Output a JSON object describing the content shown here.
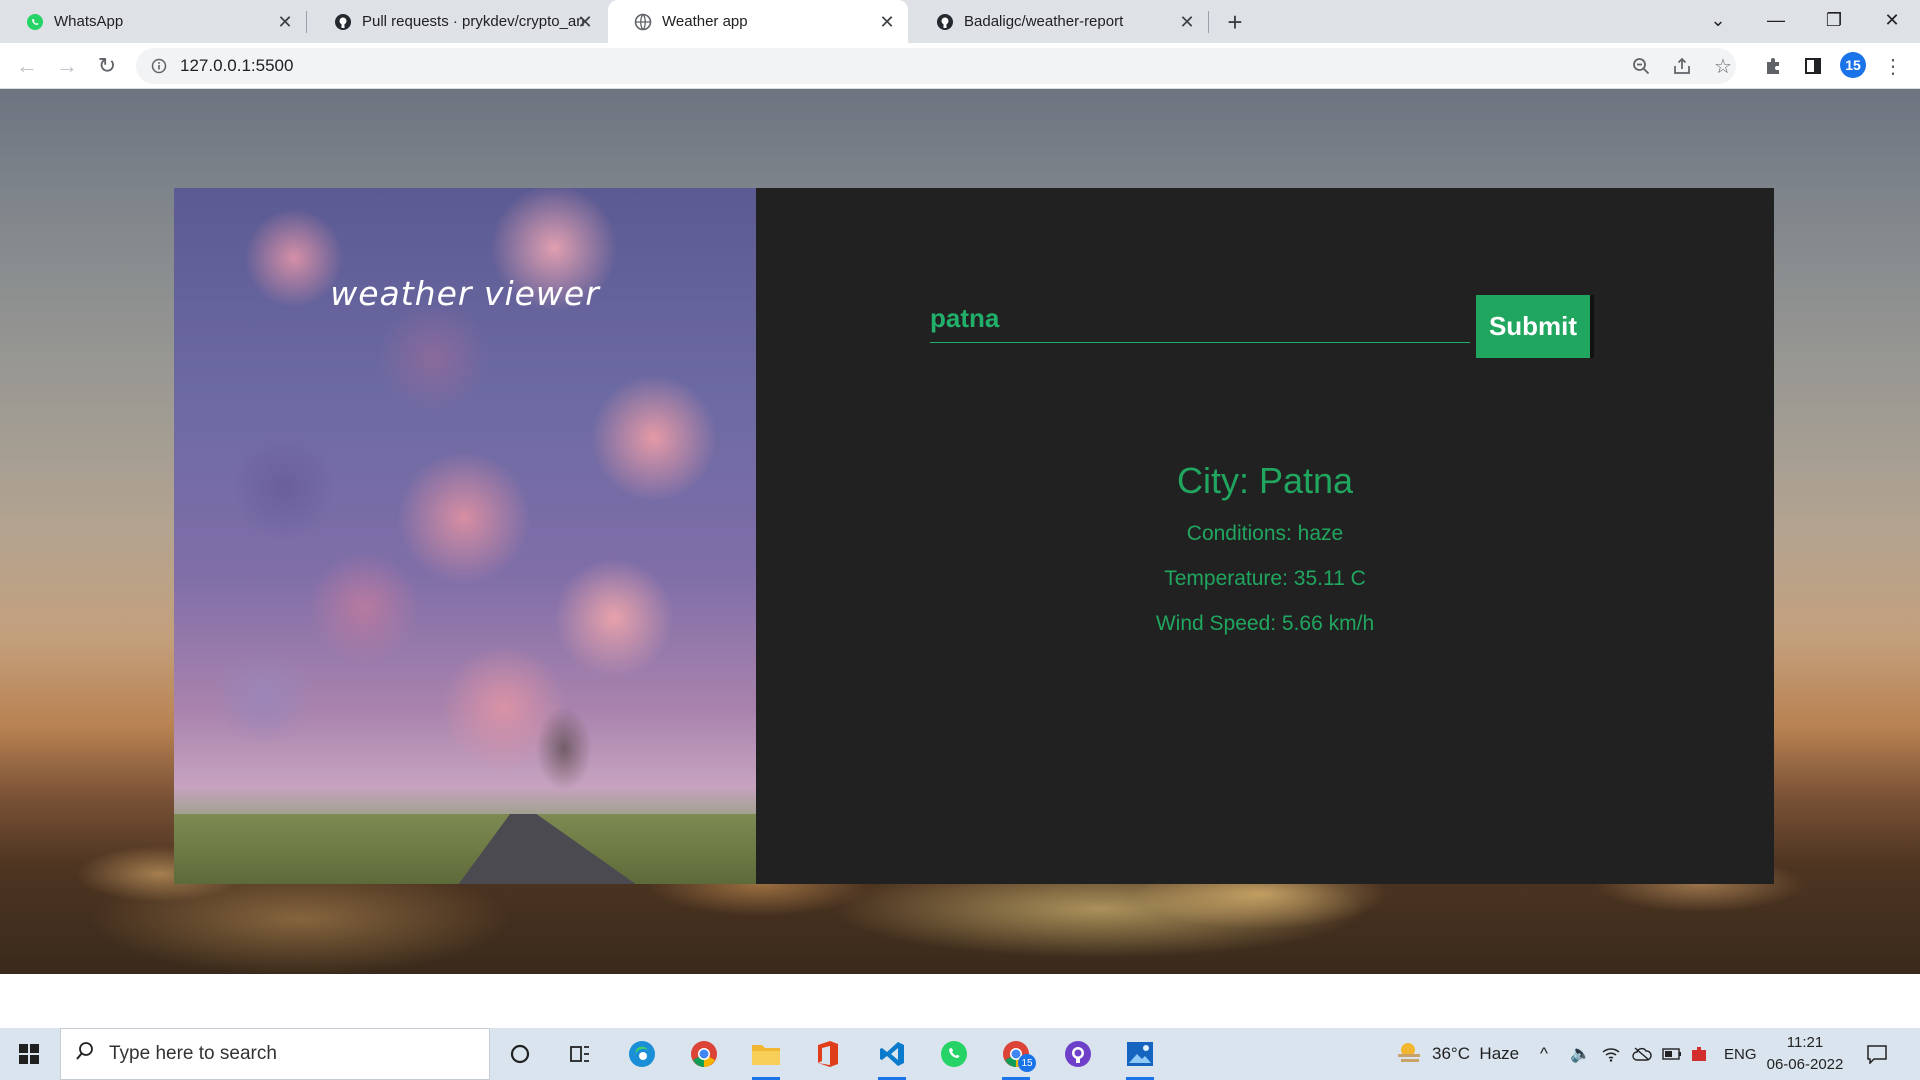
{
  "browser": {
    "tabs": [
      {
        "title": "WhatsApp",
        "icon": "whatsapp-icon"
      },
      {
        "title": "Pull requests · prykdev/crypto_an",
        "icon": "github-icon"
      },
      {
        "title": "Weather app",
        "icon": "globe-icon",
        "active": true
      },
      {
        "title": "Badaligc/weather-report",
        "icon": "github-icon"
      }
    ],
    "new_tab_symbol": "+",
    "url": "127.0.0.1:5500",
    "profile_badge": "15"
  },
  "app": {
    "title": "weather viewer",
    "search": {
      "value": "patna",
      "placeholder": ""
    },
    "submit_label": "Submit",
    "result": {
      "city": "City: Patna",
      "conditions": "Conditions: haze",
      "temperature": "Temperature: 35.11 C",
      "wind": "Wind Speed: 5.66 km/h"
    },
    "colors": {
      "accent": "#21a660",
      "panel": "#212121"
    }
  },
  "taskbar": {
    "search_placeholder": "Type here to search",
    "weather": "36°C  Haze",
    "language": "ENG",
    "time": "11:21",
    "date": "06-06-2022",
    "chrome_badge": "15"
  }
}
